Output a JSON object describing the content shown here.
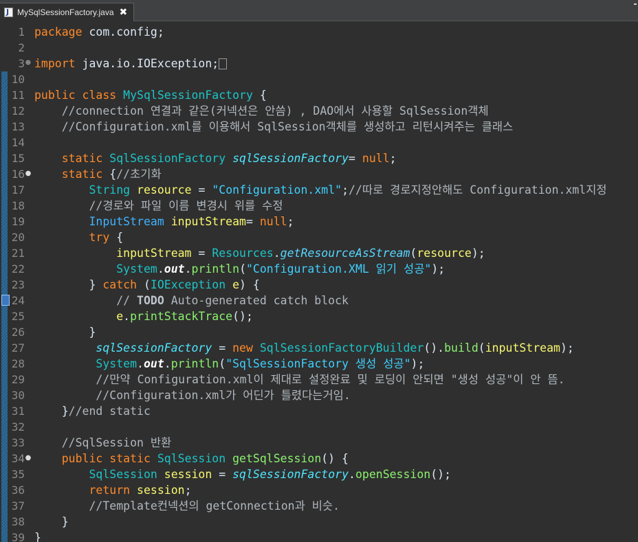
{
  "tab": {
    "filename": "MySqlSessionFactory.java",
    "close_glyph": "✖",
    "icon": "java-file-icon"
  },
  "editor": {
    "lines": [
      {
        "num": "1",
        "segments": [
          [
            "kw",
            "package"
          ],
          [
            "plain",
            " com.config;"
          ]
        ]
      },
      {
        "num": "2",
        "segments": []
      },
      {
        "num": "3",
        "fold": "⊕",
        "segments": [
          [
            "kw",
            "import"
          ],
          [
            "plain",
            " java.io.IOException;"
          ]
        ],
        "sel": true
      },
      {
        "num": "10",
        "segments": [],
        "mark": true
      },
      {
        "num": "11",
        "segments": [
          [
            "kw",
            "public class"
          ],
          [
            "plain",
            " "
          ],
          [
            "typ",
            "MySqlSessionFactory"
          ],
          [
            "plain",
            " {"
          ]
        ],
        "mark": true
      },
      {
        "num": "12",
        "segments": [
          [
            "com",
            "    //connection 연결과 같은(커넥션은 안씀) , DAO에서 사용할 SqlSession객체"
          ]
        ],
        "mark": true
      },
      {
        "num": "13",
        "segments": [
          [
            "com",
            "    //Configuration.xml를 이용해서 SqlSession객체를 생성하고 리턴시켜주는 클래스"
          ]
        ],
        "mark": true
      },
      {
        "num": "14",
        "segments": [],
        "mark": true
      },
      {
        "num": "15",
        "segments": [
          [
            "plain",
            "    "
          ],
          [
            "kw",
            "static"
          ],
          [
            "plain",
            " "
          ],
          [
            "typ",
            "SqlSessionFactory"
          ],
          [
            "plain",
            " "
          ],
          [
            "fld",
            "sqlSessionFactory"
          ],
          [
            "plain",
            "= "
          ],
          [
            "num",
            "null"
          ],
          [
            "plain",
            ";"
          ]
        ],
        "mark": true
      },
      {
        "num": "16",
        "fold": "⊖",
        "segments": [
          [
            "plain",
            "    "
          ],
          [
            "kw",
            "static"
          ],
          [
            "plain",
            " {"
          ],
          [
            "com",
            "//초기화"
          ]
        ],
        "mark": true
      },
      {
        "num": "17",
        "segments": [
          [
            "plain",
            "        "
          ],
          [
            "typ",
            "String"
          ],
          [
            "plain",
            " "
          ],
          [
            "var",
            "resource"
          ],
          [
            "plain",
            " = "
          ],
          [
            "str",
            "\"Configuration.xml\""
          ],
          [
            "plain",
            ";"
          ],
          [
            "com",
            "//따로 경로지정안해도 Configuration.xml지정"
          ]
        ],
        "mark": true
      },
      {
        "num": "18",
        "segments": [
          [
            "com",
            "        //경로와 파일 이름 변경시 위를 수정"
          ]
        ],
        "mark": true
      },
      {
        "num": "19",
        "segments": [
          [
            "plain",
            "        "
          ],
          [
            "iface",
            "InputStream"
          ],
          [
            "plain",
            " "
          ],
          [
            "var",
            "inputStream"
          ],
          [
            "plain",
            "= "
          ],
          [
            "num",
            "null"
          ],
          [
            "plain",
            ";"
          ]
        ],
        "mark": true
      },
      {
        "num": "20",
        "segments": [
          [
            "plain",
            "        "
          ],
          [
            "kw",
            "try"
          ],
          [
            "plain",
            " {"
          ]
        ],
        "mark": true
      },
      {
        "num": "21",
        "segments": [
          [
            "plain",
            "            "
          ],
          [
            "var",
            "inputStream"
          ],
          [
            "plain",
            " = "
          ],
          [
            "typ",
            "Resources"
          ],
          [
            "plain",
            "."
          ],
          [
            "ital",
            "getResourceAsStream"
          ],
          [
            "plain",
            "("
          ],
          [
            "var",
            "resource"
          ],
          [
            "plain",
            ");"
          ]
        ],
        "mark": true
      },
      {
        "num": "22",
        "segments": [
          [
            "plain",
            "            "
          ],
          [
            "sys",
            "System"
          ],
          [
            "plain",
            "."
          ],
          [
            "outf",
            "out"
          ],
          [
            "plain",
            "."
          ],
          [
            "meth",
            "println"
          ],
          [
            "plain",
            "("
          ],
          [
            "str",
            "\"Configuration.XML 읽기 성공\""
          ],
          [
            "plain",
            ");"
          ]
        ],
        "mark": true
      },
      {
        "num": "23",
        "segments": [
          [
            "plain",
            "        } "
          ],
          [
            "kw",
            "catch"
          ],
          [
            "plain",
            " ("
          ],
          [
            "typ",
            "IOException"
          ],
          [
            "plain",
            " "
          ],
          [
            "var",
            "e"
          ],
          [
            "plain",
            ") {"
          ]
        ],
        "mark": true
      },
      {
        "num": "24",
        "segments": [
          [
            "com",
            "            // "
          ],
          [
            "todo",
            "TODO"
          ],
          [
            "com",
            " Auto-generated catch block"
          ]
        ],
        "mark": true,
        "bookmark": true
      },
      {
        "num": "25",
        "segments": [
          [
            "plain",
            "            "
          ],
          [
            "var",
            "e"
          ],
          [
            "plain",
            "."
          ],
          [
            "meth",
            "printStackTrace"
          ],
          [
            "plain",
            "();"
          ]
        ],
        "mark": true
      },
      {
        "num": "26",
        "segments": [
          [
            "plain",
            "        }"
          ]
        ],
        "mark": true
      },
      {
        "num": "27",
        "segments": [
          [
            "plain",
            "         "
          ],
          [
            "fld",
            "sqlSessionFactory"
          ],
          [
            "plain",
            " = "
          ],
          [
            "kw",
            "new"
          ],
          [
            "plain",
            " "
          ],
          [
            "typ",
            "SqlSessionFactoryBuilder"
          ],
          [
            "plain",
            "()."
          ],
          [
            "meth",
            "build"
          ],
          [
            "plain",
            "("
          ],
          [
            "var",
            "inputStream"
          ],
          [
            "plain",
            ");"
          ]
        ],
        "mark": true
      },
      {
        "num": "28",
        "segments": [
          [
            "plain",
            "         "
          ],
          [
            "sys",
            "System"
          ],
          [
            "plain",
            "."
          ],
          [
            "outf",
            "out"
          ],
          [
            "plain",
            "."
          ],
          [
            "meth",
            "println"
          ],
          [
            "plain",
            "("
          ],
          [
            "str",
            "\"SqlSessionFactory 생성 성공\""
          ],
          [
            "plain",
            ");"
          ]
        ],
        "mark": true
      },
      {
        "num": "29",
        "segments": [
          [
            "com",
            "         //만약 Configuration.xml이 제대로 설정완료 및 로딩이 안되면 \"생성 성공\"이 안 뜸."
          ]
        ],
        "mark": true
      },
      {
        "num": "30",
        "segments": [
          [
            "com",
            "         //Configuration.xml가 어딘가 틀렸다는거임."
          ]
        ],
        "mark": true
      },
      {
        "num": "31",
        "segments": [
          [
            "plain",
            "    }"
          ],
          [
            "com",
            "//end static"
          ]
        ],
        "mark": true
      },
      {
        "num": "32",
        "segments": [],
        "mark": true
      },
      {
        "num": "33",
        "segments": [
          [
            "com",
            "    //SqlSession 반환"
          ]
        ],
        "mark": true
      },
      {
        "num": "34",
        "fold": "⊖",
        "segments": [
          [
            "plain",
            "    "
          ],
          [
            "kw",
            "public static"
          ],
          [
            "plain",
            " "
          ],
          [
            "typ",
            "SqlSession"
          ],
          [
            "plain",
            " "
          ],
          [
            "meth",
            "getSqlSession"
          ],
          [
            "plain",
            "() {"
          ]
        ],
        "mark": true
      },
      {
        "num": "35",
        "segments": [
          [
            "plain",
            "        "
          ],
          [
            "typ",
            "SqlSession"
          ],
          [
            "plain",
            " "
          ],
          [
            "var",
            "session"
          ],
          [
            "plain",
            " = "
          ],
          [
            "fld",
            "sqlSessionFactory"
          ],
          [
            "plain",
            "."
          ],
          [
            "meth",
            "openSession"
          ],
          [
            "plain",
            "();"
          ]
        ],
        "mark": true
      },
      {
        "num": "36",
        "segments": [
          [
            "plain",
            "        "
          ],
          [
            "kw",
            "return"
          ],
          [
            "plain",
            " "
          ],
          [
            "var",
            "session"
          ],
          [
            "plain",
            ";"
          ]
        ],
        "mark": true
      },
      {
        "num": "37",
        "segments": [
          [
            "com",
            "        //Template컨넥션의 getConnection과 비슷."
          ]
        ],
        "mark": true
      },
      {
        "num": "38",
        "segments": [
          [
            "plain",
            "    }"
          ]
        ],
        "mark": true
      },
      {
        "num": "39",
        "segments": [
          [
            "plain",
            "}"
          ]
        ],
        "mark": true
      }
    ]
  }
}
